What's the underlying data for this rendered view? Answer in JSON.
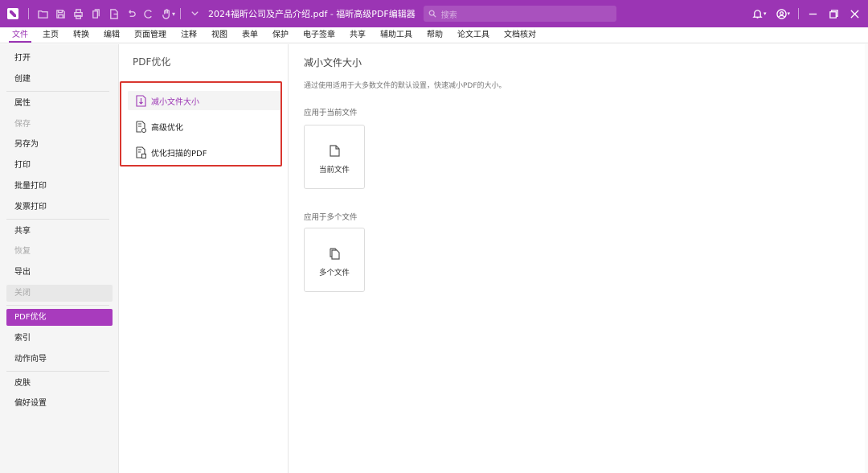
{
  "titlebar": {
    "document_title": "2024福昕公司及产品介绍.pdf - 福昕高级PDF编辑器",
    "search_placeholder": "搜索",
    "quick_access_icons": [
      "open-icon",
      "save-icon",
      "print-icon",
      "copy-icon",
      "export-icon",
      "undo-icon",
      "redo-icon",
      "hand-icon",
      "customize-icon"
    ],
    "window_icons": [
      "bell-icon",
      "user-icon",
      "minimize-icon",
      "restore-icon",
      "close-icon"
    ],
    "accent_color": "#9b35b4"
  },
  "menubar": {
    "items": [
      "文件",
      "主页",
      "转换",
      "编辑",
      "页面管理",
      "注释",
      "视图",
      "表单",
      "保护",
      "电子签章",
      "共享",
      "辅助工具",
      "帮助",
      "论文工具",
      "文档核对"
    ],
    "active": "文件"
  },
  "leftnav": {
    "items": [
      {
        "label": "打开",
        "state": "normal"
      },
      {
        "label": "创建",
        "state": "normal"
      },
      {
        "label": "属性",
        "state": "normal"
      },
      {
        "label": "保存",
        "state": "disabled"
      },
      {
        "label": "另存为",
        "state": "normal"
      },
      {
        "label": "打印",
        "state": "normal"
      },
      {
        "label": "批量打印",
        "state": "normal"
      },
      {
        "label": "发票打印",
        "state": "normal"
      },
      {
        "label": "共享",
        "state": "normal"
      },
      {
        "label": "恢复",
        "state": "disabled"
      },
      {
        "label": "导出",
        "state": "normal"
      },
      {
        "label": "关闭",
        "state": "hover"
      },
      {
        "label": "PDF优化",
        "state": "selected"
      },
      {
        "label": "索引",
        "state": "normal"
      },
      {
        "label": "动作向导",
        "state": "normal"
      },
      {
        "label": "皮肤",
        "state": "normal"
      },
      {
        "label": "偏好设置",
        "state": "normal"
      }
    ]
  },
  "midpanel": {
    "title": "PDF优化",
    "options": [
      {
        "label": "减小文件大小",
        "icon": "reduce-size-icon",
        "selected": true
      },
      {
        "label": "高级优化",
        "icon": "advanced-optimize-icon",
        "selected": false
      },
      {
        "label": "优化扫描的PDF",
        "icon": "scan-optimize-icon",
        "selected": false
      }
    ]
  },
  "content": {
    "title": "减小文件大小",
    "description": "通过使用适用于大多数文件的默认设置，快速减小PDF的大小。",
    "section_current": "应用于当前文件",
    "card_current": "当前文件",
    "section_multiple": "应用于多个文件",
    "card_multiple": "多个文件"
  }
}
